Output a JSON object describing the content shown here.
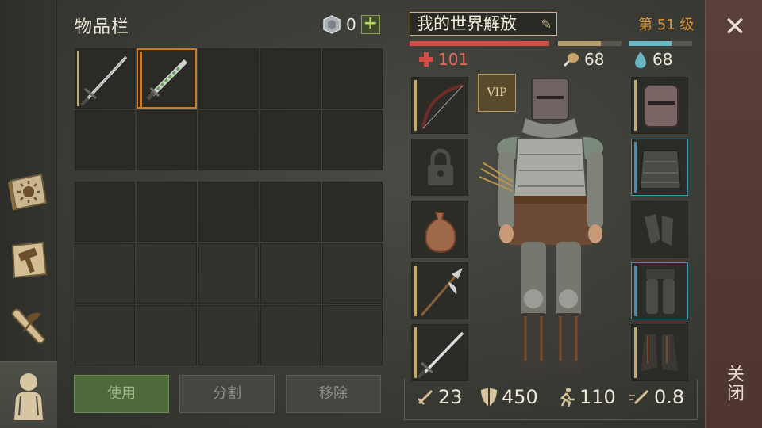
{
  "inventory": {
    "title": "物品栏",
    "coin_count": "0",
    "plus_label": "+",
    "buttons": {
      "use": "使用",
      "split": "分割",
      "remove": "移除"
    }
  },
  "character": {
    "name": "我的世界解放",
    "level": "第 51 级",
    "health": "101",
    "food": "68",
    "water": "68",
    "vip_label": "VIP"
  },
  "stats": {
    "attack": "23",
    "defense": "450",
    "speed": "110",
    "attack_speed": "0.8"
  },
  "close": {
    "label": "关闭"
  },
  "colors": {
    "health_bar": "#d24d46",
    "food_bar": "#b39a6a",
    "water_bar": "#69b7c4",
    "level": "#d9913c",
    "rarity_common": "#c8a96a",
    "rarity_rare": "#3e94b8",
    "selected": "#c77a28"
  },
  "icons": {
    "tabs": [
      "journal-sun-icon",
      "crafting-hammer-icon",
      "quest-scroll-icon",
      "character-icon"
    ],
    "coin": "gem-coin-icon",
    "health": "cross-icon",
    "food": "drumstick-icon",
    "water": "drop-icon",
    "stats": [
      "sword-icon",
      "shield-icon",
      "running-icon",
      "sword-speed-icon"
    ]
  }
}
